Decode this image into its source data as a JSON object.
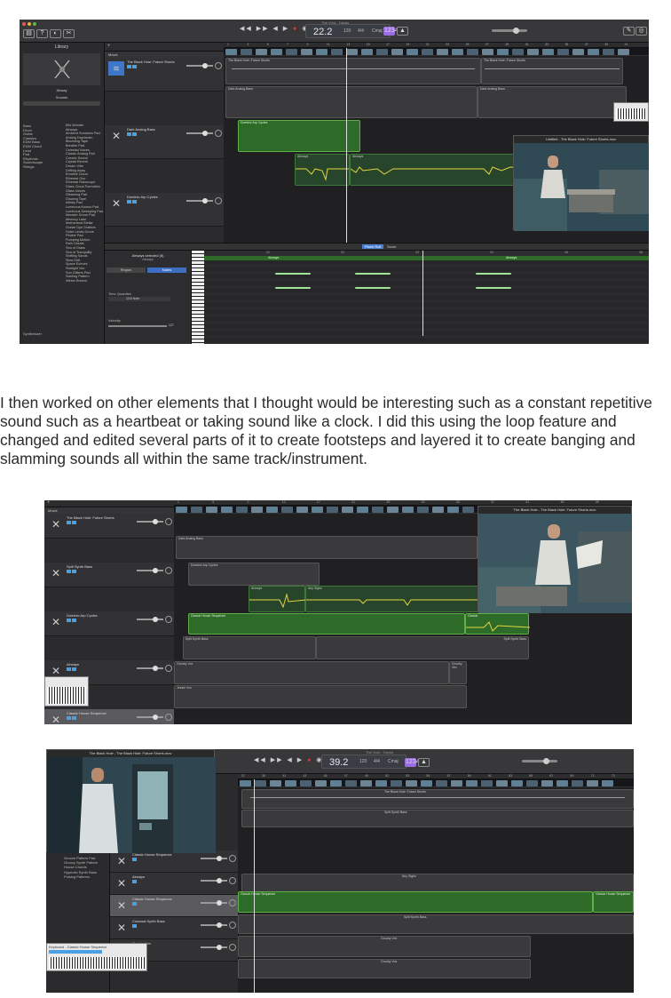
{
  "paragraph": "I then worked on other elements that I thought would be interesting such as a constant repetitive sound such as a heartbeat or taking sound like a clock. I did this using the loop feature and changed and edited several parts of it to create footsteps and layered it to create banging and slamming sounds all within the same track/instrument.",
  "colors": {
    "region_green": "#2e6b28",
    "region_border_green": "#5fb048",
    "note_green": "#9ee59b",
    "waveform_yellow": "#e6d540",
    "accent_blue": "#4aa0e0",
    "purple_button": "#9a6de0"
  },
  "shot1": {
    "window_title": "The Void - Tracks",
    "lcd_time": "22.2",
    "lcd_tempo": "120",
    "lcd_sig": "4/4",
    "lcd_key": "Cmaj",
    "library": {
      "header": "Library",
      "patch_name": "Airway",
      "sounds_header": "Sounds",
      "categories": [
        "Bass",
        "Drum",
        "Guitar",
        "Classics",
        "EDM Bass",
        "EDM Chord",
        "Lead",
        "Pad",
        "Rhythmic",
        "Soundscape",
        "Strings"
      ],
      "sounds": [
        "80s Wonder",
        "Airways",
        "Ambient Sundown Pad",
        "Analog Daydream",
        "Blooming Tape",
        "Breathe Pad",
        "Celestial Voices",
        "Classic Analog Pad",
        "Cosmic Sound",
        "Crystal Reverb",
        "Dream Vibe",
        "Drifting Away",
        "Emotive Cloud",
        "Ethereal Goo",
        "Ethereal Rotoscope",
        "Glass Cloud Formation",
        "Glass Voices",
        "Gleaming Pad",
        "Glowing Tape",
        "Infinity Pad",
        "Luminous Kosmo Pad",
        "Luminous Sweeping Pad",
        "Monster Drone Pad",
        "Memory Lane",
        "Motherland Stellar",
        "Ocean Dyn Grafters",
        "Outer Limits Drone",
        "Pewter Pad",
        "Pumping Motion",
        "Rain Clouds",
        "Sea of Glass",
        "Sea of Tranquility",
        "Shifting Sands",
        "Slow Drift",
        "Space Echoes",
        "Starlight Vox",
        "Sun Glitters Pad",
        "Swirling Pattern",
        "Winter Breeze"
      ],
      "footer": "Synthesizer"
    },
    "tracks": [
      {
        "name": "The Black Hole: Future Shorts",
        "icon": "audio-icon"
      },
      {
        "name": "Dark Analog Bass",
        "icon": "synth-icon"
      },
      {
        "name": "Dominic Arp Cycles",
        "icon": "synth-icon"
      },
      {
        "name": "Airways",
        "icon": "synth-icon"
      }
    ],
    "regions": [
      {
        "label": "The Black Hole: Future Shorts"
      },
      {
        "label": "The Black Hole: Future Shorts"
      },
      {
        "label": "Dark Analog Bass"
      },
      {
        "label": "Dark Analog Bass"
      },
      {
        "label": "Dominic Arp Cycles"
      },
      {
        "label": "Airways"
      },
      {
        "label": "Airways"
      }
    ],
    "ruler": [
      "1",
      "3",
      "5",
      "7",
      "9",
      "11",
      "13",
      "15",
      "17",
      "19",
      "21",
      "23",
      "25",
      "27",
      "29",
      "31",
      "33",
      "35",
      "37",
      "39",
      "41"
    ],
    "video_title": "Untitled - The Black Hole: Future Shorts.mov",
    "editor": {
      "tabs": [
        "Piano Roll",
        "Score"
      ],
      "region_name": "Airways selected (6)",
      "region_sub": "Airways",
      "btn_region": "Region",
      "btn_notes": "Notes",
      "time_quant_label": "Time Quantize",
      "time_quant_value": "1/16 Note",
      "velocity_label": "Velocity",
      "velocity_value": "127",
      "region_label_1": "Airways",
      "region_label_2": "Airways",
      "ruler": [
        "21",
        "22",
        "23",
        "24",
        "25",
        "26",
        "27"
      ]
    }
  },
  "shot2": {
    "window_title": "Untitled - The Black Hole: Future Shorts",
    "tracks": [
      {
        "name": "The Black Hole: Future Shorts"
      },
      {
        "name": "Spilt Synth Bass"
      },
      {
        "name": "Dominic Arp Cycles"
      },
      {
        "name": "Airways"
      },
      {
        "name": "Classic House Sequence"
      },
      {
        "name": "Colossal Synth Bass"
      },
      {
        "name": "Grooby Vox"
      },
      {
        "name": "Jessie"
      }
    ],
    "regions": [
      {
        "label": "Dark Analog Bass"
      },
      {
        "label": "Dark Analog Bass"
      },
      {
        "label": "Dominic Arp Cycles"
      },
      {
        "label": "Airways"
      },
      {
        "label": "Airy Sighs"
      },
      {
        "label": "Classic House Sequence"
      },
      {
        "label": "Classic"
      },
      {
        "label": "Spilt Synth Bass"
      },
      {
        "label": "Spilt Synth Bass"
      },
      {
        "label": "Grooby Vox"
      },
      {
        "label": "Grooby Vox"
      },
      {
        "label": "Jessie Vox"
      }
    ],
    "video_title": "The Black Hole - The Black Hole: Future Shorts.mov",
    "ruler": [
      "1",
      "5",
      "9",
      "13",
      "17",
      "21",
      "25",
      "29",
      "33",
      "37",
      "41",
      "45",
      "49"
    ]
  },
  "shot3": {
    "video_title": "The Black Hole - The Black Hole: Future Shorts.mov",
    "window_title": "The Void - Tracks",
    "lcd_time": "39.2",
    "lcd_tempo": "120",
    "lcd_sig": "4/4",
    "lcd_key": "Cmaj",
    "library_items": [
      "Groove Pattern Pad",
      "Groovy Synth Pattern",
      "House Chords",
      "Hypnotic Synth Bass",
      "Pulsing Patterns"
    ],
    "tracks": [
      {
        "name": "Classic House Sequence"
      },
      {
        "name": "Airways"
      },
      {
        "name": "Classic House Sequence"
      },
      {
        "name": "Colossal Synth Bass"
      },
      {
        "name": "Grooby Vox"
      }
    ],
    "regions": [
      {
        "label": "The Black Hole: Future Shorts"
      },
      {
        "label": "Spilt Synth Bass"
      },
      {
        "label": "Airy Sighs"
      },
      {
        "label": "Classic House Sequence"
      },
      {
        "label": "Classic House Sequence"
      },
      {
        "label": "Spilt Synth Bass"
      },
      {
        "label": "Grooby Vox"
      },
      {
        "label": "Grooby Vox"
      }
    ],
    "keyboard_label": "Keyboard - Classic House Sequence",
    "ruler": [
      "37",
      "39",
      "41",
      "43",
      "45",
      "47",
      "49",
      "51",
      "53",
      "55",
      "57",
      "59",
      "61",
      "63",
      "65",
      "67",
      "69",
      "71",
      "73"
    ]
  }
}
